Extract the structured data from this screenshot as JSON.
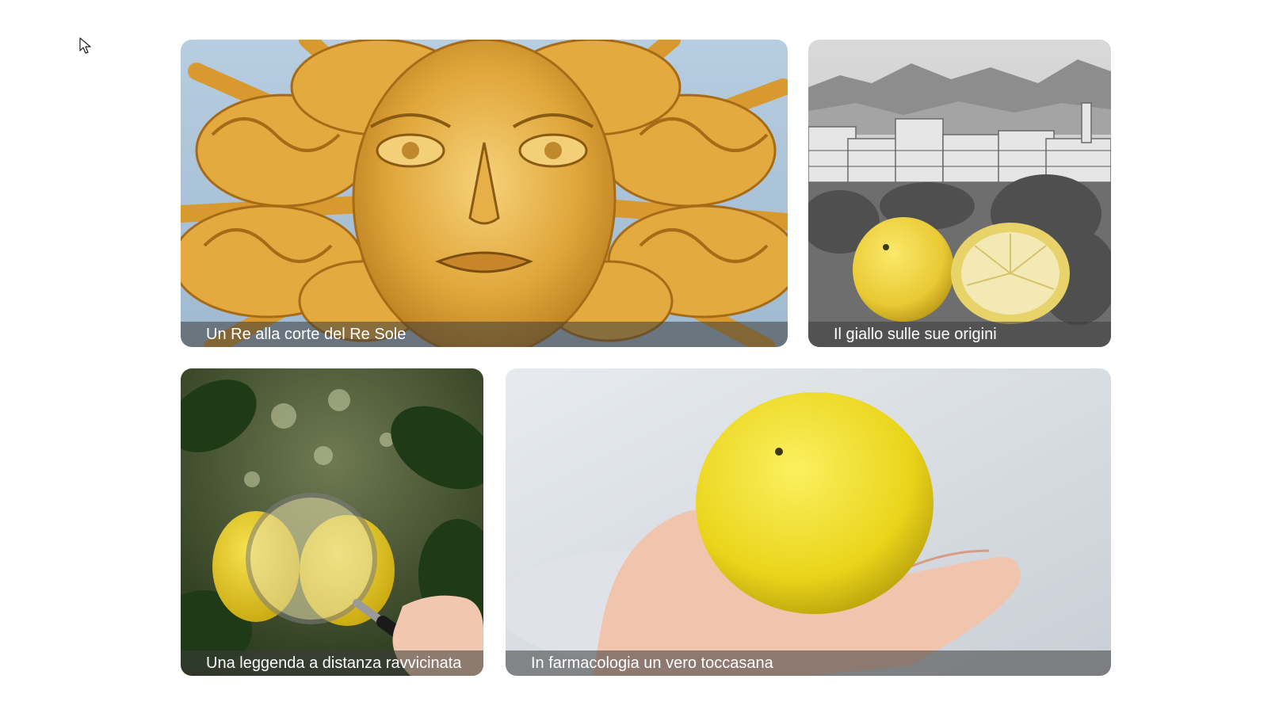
{
  "cards": [
    {
      "title": "Un Re alla corte del Re Sole",
      "image": "golden-sun-face-sculpture"
    },
    {
      "title": "Il giallo sulle sue origini",
      "image": "engraved-town-with-citrus-fruit"
    },
    {
      "title": "Una leggenda a distanza ravvicinata",
      "image": "magnifying-glass-over-citrus-tree"
    },
    {
      "title": "In farmacologia un vero toccasana",
      "image": "hand-holding-yellow-citrus"
    }
  ],
  "colors": {
    "caption_overlay": "#3c3c3c",
    "caption_text": "#ffffff",
    "background": "#ffffff"
  },
  "icons": {
    "cursor": "mouse-pointer-icon"
  }
}
